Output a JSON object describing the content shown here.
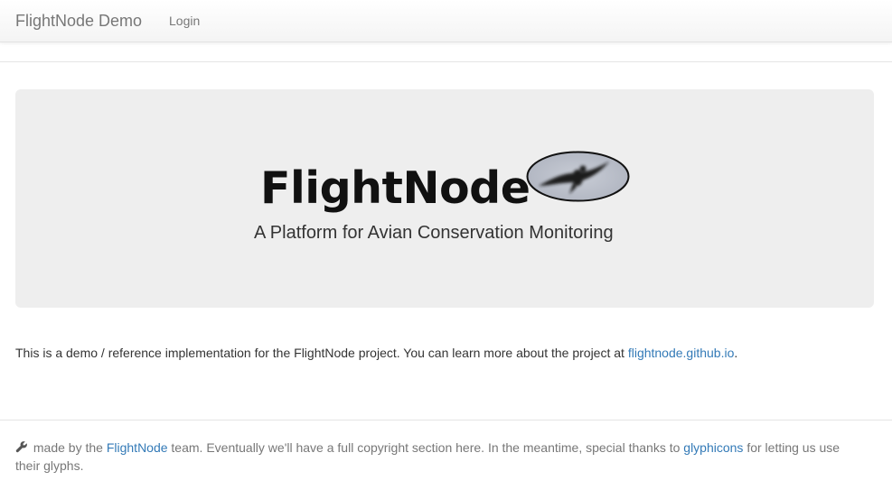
{
  "navbar": {
    "brand": "FlightNode Demo",
    "login_label": "Login"
  },
  "jumbotron": {
    "logo_text": "FlightNode",
    "tagline": "A Platform for Avian Conservation Monitoring"
  },
  "intro": {
    "text": "This is a demo / reference implementation for the FlightNode project. You can learn more about the project at ",
    "link_label": "flightnode.github.io",
    "suffix": "."
  },
  "footer": {
    "icon": "wrench-icon",
    "part1": " made by the ",
    "team_link": "FlightNode",
    "part2": " team. Eventually we'll have a full copyright section here. In the meantime, special thanks to ",
    "glyphicons_link": "glyphicons",
    "part3": " for letting us use their glyphs."
  },
  "colors": {
    "link": "#337ab7",
    "muted": "#777777",
    "jumbotron_bg": "#eeeeee"
  }
}
